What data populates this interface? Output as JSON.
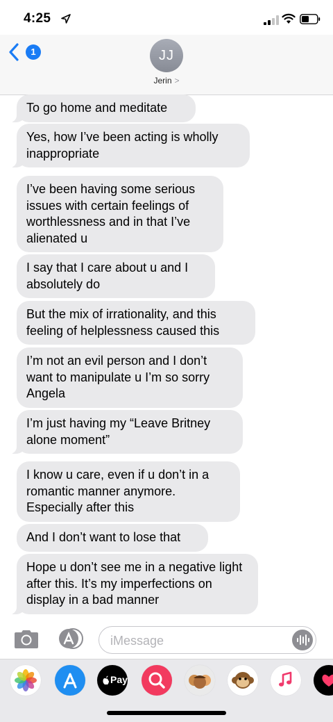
{
  "status_bar": {
    "time": "4:25"
  },
  "header": {
    "back_badge": "1",
    "avatar_initials": "JJ",
    "contact_name": "Jerin",
    "contact_chevron": ">"
  },
  "messages": [
    {
      "text": "To go home and meditate"
    },
    {
      "text": "Yes, how I’ve been acting is wholly inappropriate"
    },
    {
      "text": "I’ve been having some serious issues with certain feelings of worthlessness and in that I’ve alienated u"
    },
    {
      "text": "I say that I care about u and I absolutely do"
    },
    {
      "text": "But the mix of  irrationality, and this feeling of helplessness caused this"
    },
    {
      "text": "I’m not an evil person and I don’t want to manipulate u I’m so sorry Angela"
    },
    {
      "text": "I’m just having my “Leave Britney alone moment”"
    },
    {
      "text": "I know u care, even if u don’t in a romantic manner anymore. Especially after this"
    },
    {
      "text": "And I don’t want to lose that"
    },
    {
      "text": "Hope u don’t see me in a negative light after this. It’s my imperfections on display in a bad manner"
    }
  ],
  "input": {
    "placeholder": "iMessage"
  },
  "drawer": {
    "apple_pay_label": "Pay",
    "apps": [
      "photos-icon",
      "app-store-icon",
      "apple-pay-icon",
      "search-images-icon",
      "animoji-avatars-icon",
      "monkey-animoji-icon",
      "music-icon",
      "digital-touch-icon"
    ]
  },
  "colors": {
    "accent": "#1a7cf5",
    "bubble_gray": "#e9e9eb",
    "header_bg": "#f7f7f7",
    "drawer_bg": "#e9e9ec"
  }
}
